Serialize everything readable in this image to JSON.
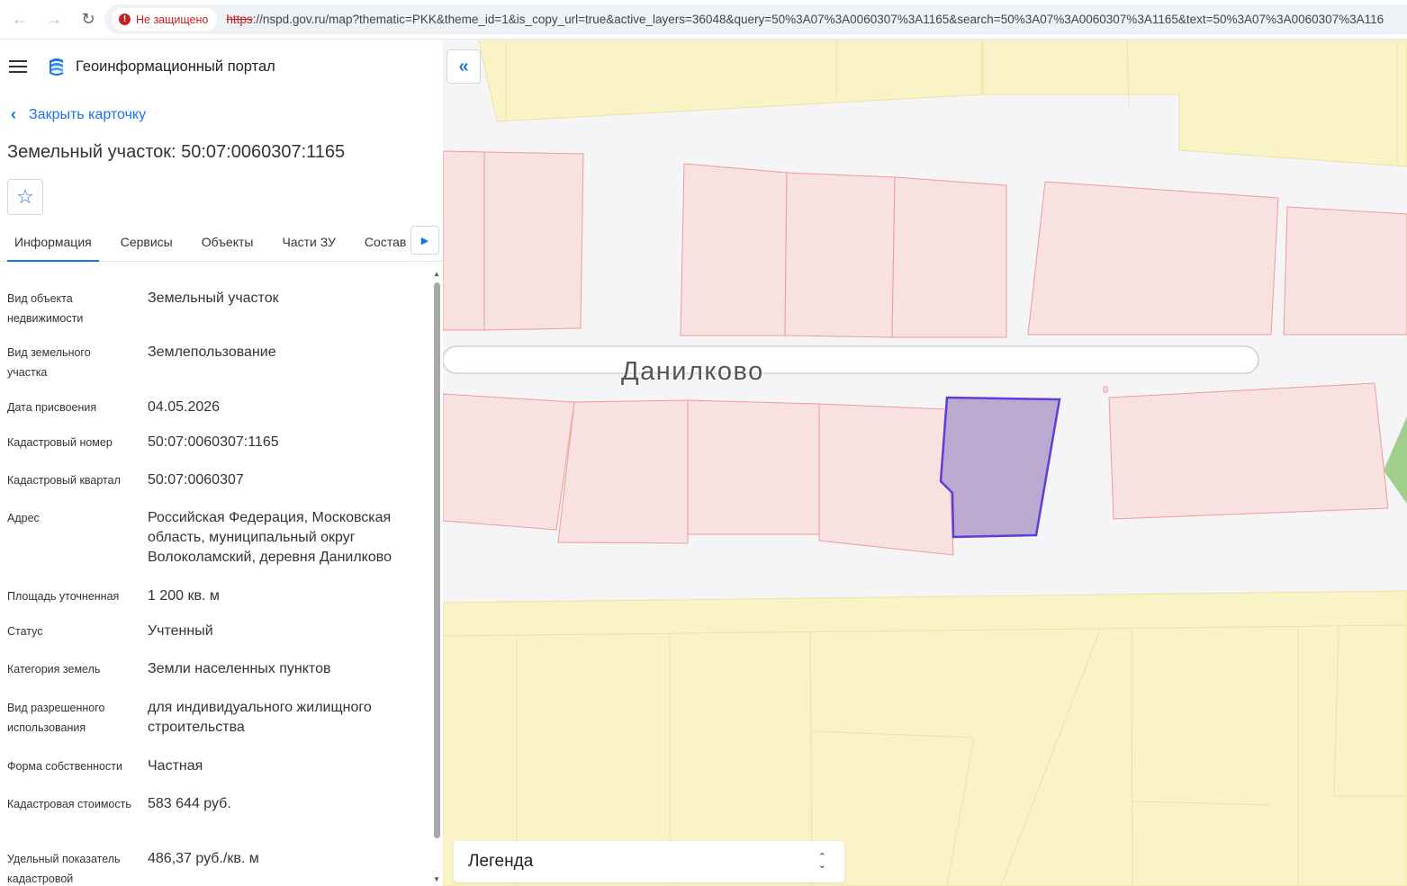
{
  "browser": {
    "security_label": "Не защищено",
    "url_scheme": "https",
    "url_rest": "://nspd.gov.ru/map?thematic=PKK&theme_id=1&is_copy_url=true&active_layers=36048&query=50%3A07%3A0060307%3A1165&search=50%3A07%3A0060307%3A1165&text=50%3A07%3A0060307%3A116"
  },
  "app": {
    "title": "Геоинформационный портал",
    "back_label": "Закрыть карточку",
    "card_title": "Земельный участок: 50:07:0060307:1165"
  },
  "tabs": [
    {
      "label": "Информация",
      "active": true
    },
    {
      "label": "Сервисы",
      "active": false
    },
    {
      "label": "Объекты",
      "active": false
    },
    {
      "label": "Части ЗУ",
      "active": false
    },
    {
      "label": "Состав",
      "active": false
    }
  ],
  "properties": [
    {
      "label": "Вид объекта недвижимости",
      "value": "Земельный участок"
    },
    {
      "label": "Вид земельного участка",
      "value": "Землепользование"
    },
    {
      "label": "Дата присвоения",
      "value": "04.05.2026"
    },
    {
      "label": "Кадастровый номер",
      "value": "50:07:0060307:1165"
    },
    {
      "label": "Кадастровый квартал",
      "value": "50:07:0060307"
    },
    {
      "label": "Адрес",
      "value": "Российская Федерация, Московская область, муниципальный округ Волоколамский, деревня Данилково"
    },
    {
      "label": "Площадь уточненная",
      "value": "1 200 кв. м"
    },
    {
      "label": "Статус",
      "value": "Учтенный"
    },
    {
      "label": "Категория земель",
      "value": "Земли населенных пунктов"
    },
    {
      "label": "Вид разрешенного использования",
      "value": "для индивидуального жилищного строительства"
    },
    {
      "label": "Форма собственности",
      "value": "Частная"
    },
    {
      "label": "Кадастровая стоимость",
      "value": "583 644 руб."
    },
    {
      "label": "Удельный показатель кадастровой",
      "value": "486,37 руб./кв. м"
    }
  ],
  "map": {
    "street_label": "Данилково",
    "legend_label": "Легенда",
    "colors": {
      "background": "#f5f4f7",
      "zone_fill": "#faf3c8",
      "zone_stroke": "#ece2a0",
      "parcel_fill": "#f7e1e1",
      "parcel_stroke": "#ef9c96",
      "selected_fill": "#bca9d2",
      "selected_stroke": "#5b3fd6",
      "green": "#9fcf8a"
    }
  },
  "icons": {
    "back": "arrow-left-icon",
    "forward": "arrow-right-icon",
    "reload": "reload-icon",
    "menu": "hamburger-icon",
    "logo": "portal-logo-icon",
    "favorite": "star-icon",
    "tab_next": "caret-right-icon",
    "collapse": "double-chevron-left-icon",
    "legend_toggle": "sort-arrows-icon"
  }
}
